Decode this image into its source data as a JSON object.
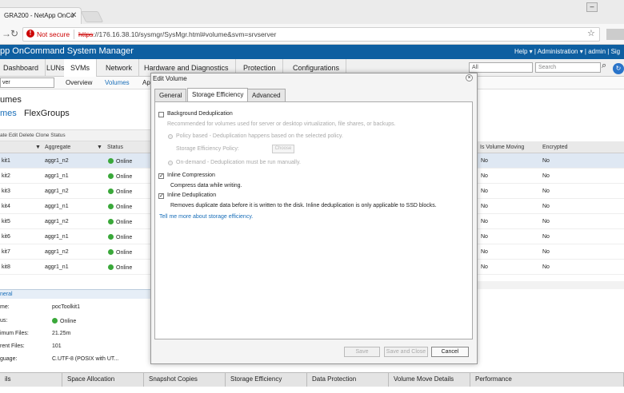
{
  "browser": {
    "tab_title": "GRA200 - NetApp OnCo",
    "not_secure": "Not secure",
    "url_scheme": "https",
    "url_rest": "://176.16.38.10/sysmgr/SysMgr.html#volume&svm=srvserver"
  },
  "app": {
    "title": "pp OnCommand System Manager",
    "help": "Help",
    "administration": "Administration",
    "user": "admin",
    "sign": "Sig"
  },
  "main_nav": [
    "Dashboard",
    "LUNs",
    "SVMs",
    "Network",
    "Hardware and Diagnostics",
    "Protection",
    "Configurations"
  ],
  "svm_filter": "All",
  "search_placeholder": "Search",
  "svm_select": "ver",
  "sub_nav": [
    "Overview",
    "Volumes",
    "Ap"
  ],
  "page_title": "umes",
  "vol_tabs": {
    "first": "mes",
    "second": "FlexGroups"
  },
  "toolbar": "ate  Edit  Delete  Clone  Status",
  "grid": {
    "headers": [
      "Aggregate",
      "Status"
    ],
    "right_headers": [
      "Is Volume Moving",
      "Encrypted"
    ],
    "rows": [
      {
        "name": "kit1",
        "aggr": "aggr1_n2",
        "status": "Online",
        "moving": "No",
        "enc": "No"
      },
      {
        "name": "kit2",
        "aggr": "aggr1_n1",
        "status": "Online",
        "moving": "No",
        "enc": "No"
      },
      {
        "name": "kit3",
        "aggr": "aggr1_n2",
        "status": "Online",
        "moving": "No",
        "enc": "No"
      },
      {
        "name": "kit4",
        "aggr": "aggr1_n1",
        "status": "Online",
        "moving": "No",
        "enc": "No"
      },
      {
        "name": "kit5",
        "aggr": "aggr1_n2",
        "status": "Online",
        "moving": "No",
        "enc": "No"
      },
      {
        "name": "kit6",
        "aggr": "aggr1_n1",
        "status": "Online",
        "moving": "No",
        "enc": "No"
      },
      {
        "name": "kit7",
        "aggr": "aggr1_n2",
        "status": "Online",
        "moving": "No",
        "enc": "No"
      },
      {
        "name": "kit8",
        "aggr": "aggr1_n1",
        "status": "Online",
        "moving": "No",
        "enc": "No"
      }
    ]
  },
  "details": {
    "header": "neral",
    "rows": [
      {
        "label": "me:",
        "value": "pocToolkit1"
      },
      {
        "label": "us:",
        "value": "Online"
      },
      {
        "label": "imum Files:",
        "value": "21.25m"
      },
      {
        "label": "rent Files:",
        "value": "101"
      },
      {
        "label": "guage:",
        "value": "C.UTF-8 (POSIX with UT..."
      }
    ]
  },
  "bottom_tabs": [
    "ils",
    "Space Allocation",
    "Snapshot Copies",
    "Storage Efficiency",
    "Data Protection",
    "Volume Move Details",
    "Performance"
  ],
  "modal": {
    "title": "Edit Volume",
    "tabs": [
      "General",
      "Storage Efficiency",
      "Advanced"
    ],
    "bg_dedup": "Background Deduplication",
    "bg_dedup_desc": "Recommended for volumes used for server or desktop virtualization, file shares, or backups.",
    "policy_based": "Policy based - Deduplication happens based on the selected policy.",
    "policy_label": "Storage Efficiency Policy:",
    "policy_button": "Choose",
    "on_demand": "On-demand - Deduplication must be run manually.",
    "inline_comp": "Inline Compression",
    "inline_comp_desc": "Compress data while writing.",
    "inline_dedup": "Inline Deduplication",
    "inline_dedup_desc": "Removes duplicate data before it is written to the disk. Inline deduplication is only applicable to SSD blocks.",
    "learn_more": "Tell me more about storage efficiency.",
    "save": "Save",
    "save_close": "Save and Close",
    "cancel": "Cancel"
  }
}
